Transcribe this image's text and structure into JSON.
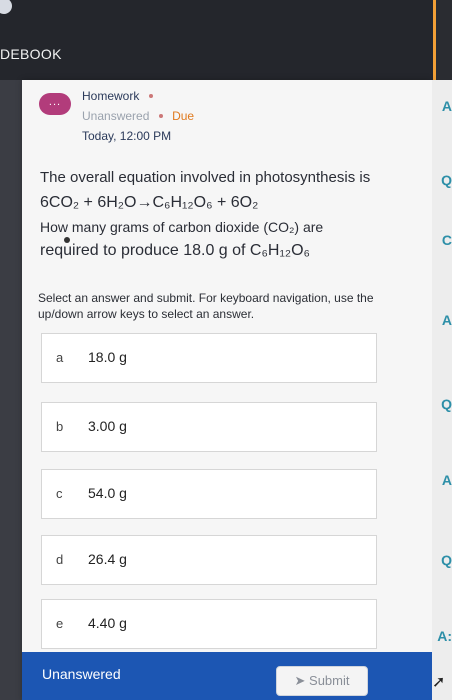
{
  "topbar": {
    "title": "DEBOOK"
  },
  "assignment": {
    "label": "Homework",
    "status": "Unanswered",
    "due_label": "Due",
    "due_time": "Today, 12:00 PM",
    "menu_label": "..."
  },
  "question": {
    "line1": "The overall equation involved in photosynthesis is",
    "equation": "6CO₂ + 6H₂O→C₆H₁₂O₆ + 6O₂",
    "line3": "How many grams of carbon dioxide (CO₂) are",
    "line4": "required to produce 18.0 g of C₆H₁₂O₆"
  },
  "instructions": "Select an answer and submit. For keyboard navigation, use the up/down arrow keys to select an answer.",
  "options": [
    {
      "letter": "a",
      "value": "18.0 g"
    },
    {
      "letter": "b",
      "value": "3.00 g"
    },
    {
      "letter": "c",
      "value": "54.0 g"
    },
    {
      "letter": "d",
      "value": "26.4 g"
    },
    {
      "letter": "e",
      "value": "4.40 g"
    }
  ],
  "footer": {
    "status": "Unanswered",
    "submit_label": "Submit"
  },
  "right_strip": [
    "A",
    "Q",
    "C",
    "A",
    "Q",
    "A",
    "Q",
    "A:"
  ],
  "colors": {
    "accent_blue": "#1c56b3",
    "menu_pill": "#b23c7b",
    "due_orange": "#e07a1f"
  }
}
